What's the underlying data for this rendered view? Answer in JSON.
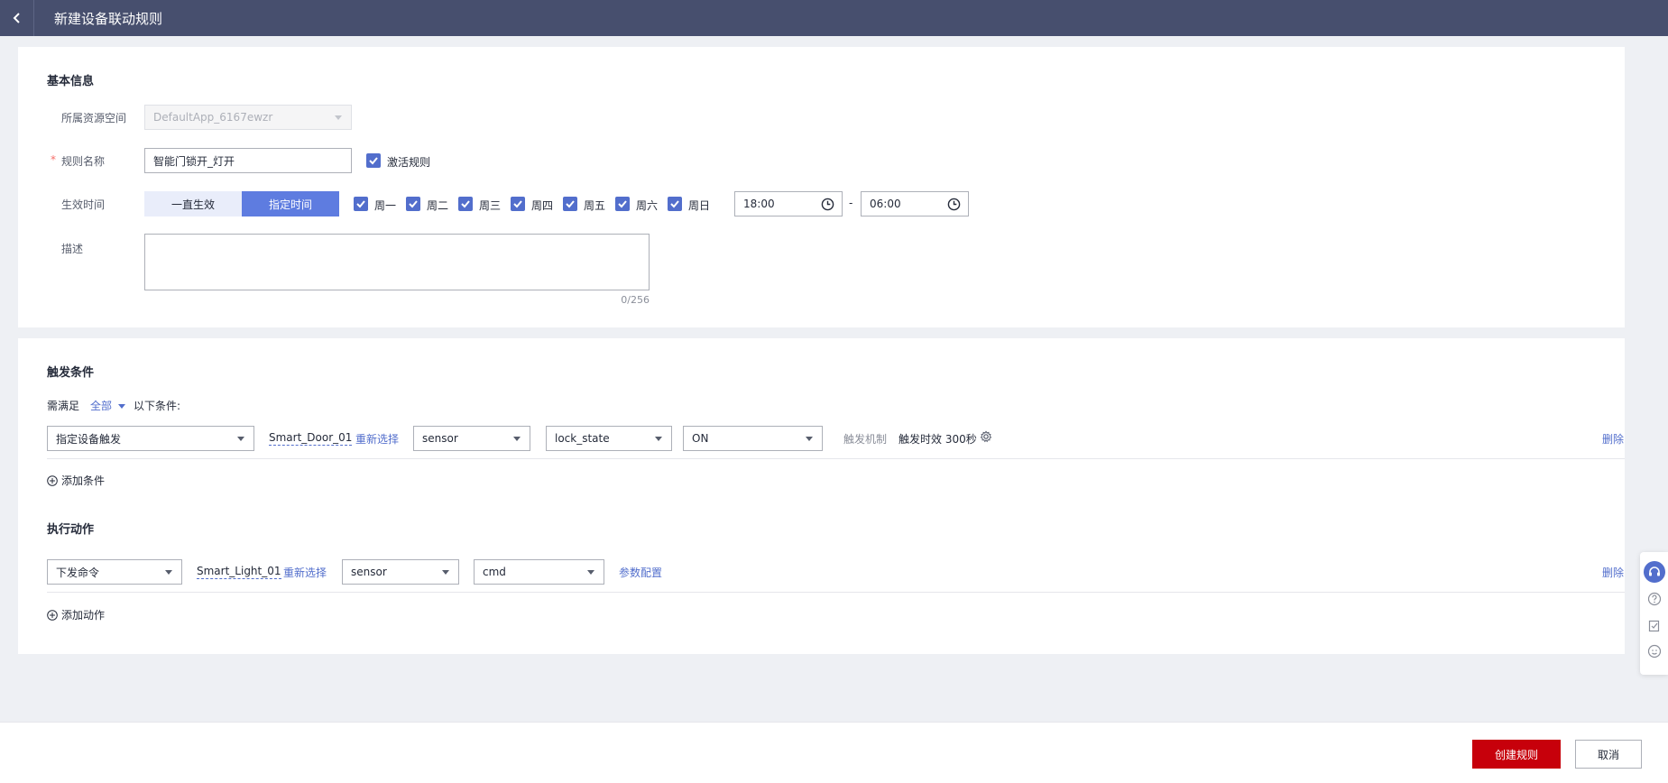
{
  "header": {
    "title": "新建设备联动规则"
  },
  "basic": {
    "section_title": "基本信息",
    "space_label": "所属资源空间",
    "space_value": "DefaultApp_6167ewzr",
    "name_label": "规则名称",
    "name_required": "*",
    "name_value": "智能门锁开_灯开",
    "activate_label": "激活规则",
    "time_label": "生效时间",
    "always_label": "一直生效",
    "specified_label": "指定时间",
    "days": [
      "周一",
      "周二",
      "周三",
      "周四",
      "周五",
      "周六",
      "周日"
    ],
    "start_time": "18:00",
    "time_sep": "-",
    "end_time": "06:00",
    "desc_label": "描述",
    "desc_counter": "0/256"
  },
  "trigger": {
    "section_title": "触发条件",
    "prefix": "需满足",
    "mode": "全部",
    "suffix": "以下条件:",
    "type_value": "指定设备触发",
    "device": "Smart_Door_01",
    "reselect": "重新选择",
    "service": "sensor",
    "property": "lock_state",
    "value": "ON",
    "mechanism_label": "触发机制",
    "mechanism_value": "触发时效 300秒",
    "delete": "删除",
    "add": "添加条件"
  },
  "action": {
    "section_title": "执行动作",
    "type_value": "下发命令",
    "device": "Smart_Light_01",
    "reselect": "重新选择",
    "service": "sensor",
    "command": "cmd",
    "params": "参数配置",
    "delete": "删除",
    "add": "添加动作"
  },
  "footer": {
    "create": "创建规则",
    "cancel": "取消"
  },
  "colors": {
    "header_bg": "#474f6e",
    "primary": "#5e7ce0",
    "link": "#526ecc",
    "danger": "#c7000b"
  }
}
